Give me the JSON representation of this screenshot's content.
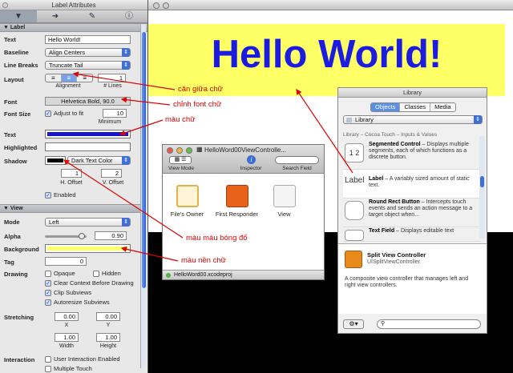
{
  "inspector": {
    "title": "Label Attributes",
    "section_label": "Label",
    "text_label": "Text",
    "text_value": "Hello World!",
    "baseline_label": "Baseline",
    "baseline_value": "Align Centers",
    "linebreaks_label": "Line Breaks",
    "linebreaks_value": "Truncate Tail",
    "layout_label": "Layout",
    "lines_value": "1",
    "alignment_caption": "Alignment",
    "lines_caption": "# Lines",
    "font_label": "Font",
    "font_value": "Helvetica Bold, 90.0",
    "fontsize_label": "Font Size",
    "adjust_label": "Adjust to fit",
    "minimum_value": "10",
    "minimum_caption": "Minimum",
    "textcolor_label": "Text",
    "highlighted_label": "Highlighted",
    "shadow_label": "Shadow",
    "shadow_value": "Dark Text Color",
    "hoffset_value": "1",
    "voffset_value": "2",
    "hoffset_caption": "H. Offset",
    "voffset_caption": "V. Offset",
    "enabled_label": "Enabled",
    "view_section": "View",
    "mode_label": "Mode",
    "mode_value": "Left",
    "alpha_label": "Alpha",
    "alpha_value": "0.90",
    "background_label": "Background",
    "tag_label": "Tag",
    "tag_value": "0",
    "drawing_label": "Drawing",
    "opaque_label": "Opaque",
    "hidden_label": "Hidden",
    "clear_label": "Clear Context Before Drawing",
    "clip_label": "Clip Subviews",
    "autoresize_label": "Autoresize Subviews",
    "stretching_label": "Stretching",
    "stretch_x": "0.00",
    "stretch_y": "0.00",
    "x_caption": "X",
    "y_caption": "Y",
    "stretch_w": "1.00",
    "stretch_h": "1.00",
    "width_caption": "Width",
    "height_caption": "Height",
    "interaction_label": "Interaction",
    "user_interaction_label": "User Interaction Enabled",
    "multiple_touch_label": "Multiple Touch"
  },
  "canvas": {
    "hello": "Hello World!"
  },
  "library": {
    "title": "Library",
    "tab_objects": "Objects",
    "tab_classes": "Classes",
    "tab_media": "Media",
    "dropdown": "Library",
    "breadcrumb": "Library – Cocoa Touch – Inputs & Values",
    "items": [
      {
        "icon": "1 2",
        "name": "Segmented Control",
        "desc": " – Displays multiple segments, each of which functions as a discrete button."
      },
      {
        "icon": "Label",
        "name": "Label",
        "desc": " – A variably sized amount of static text."
      },
      {
        "icon": "",
        "name": "Round Rect Button",
        "desc": " – Intercepts touch events and sends an action message to a target object when..."
      },
      {
        "icon": "",
        "name": "Text Field",
        "desc": " – Displays editable text"
      }
    ],
    "detail_name": "Split View Controller",
    "detail_class": "UISplitViewController",
    "detail_desc": "A composite view controller that manages left and right view controllers."
  },
  "controller": {
    "title": "HelloWord00ViewControlle...",
    "viewmode": "View Mode",
    "inspector": "Inspector",
    "searchfield": "Search Field",
    "objects": [
      "File's Owner",
      "First Responder",
      "View"
    ],
    "footer": "HelloWord00.xcodeproj"
  },
  "annotations": {
    "center": "căn giữa chữ",
    "font": "chỉnh font chữ",
    "color": "màu chữ",
    "shadow": "màu màu bóng đổ",
    "background": "màu nền chữ"
  },
  "colors": {
    "text_color": "#1515d0",
    "shadow_color": "#000000",
    "background_color": "#ffff66",
    "annotation": "#dd0000"
  }
}
